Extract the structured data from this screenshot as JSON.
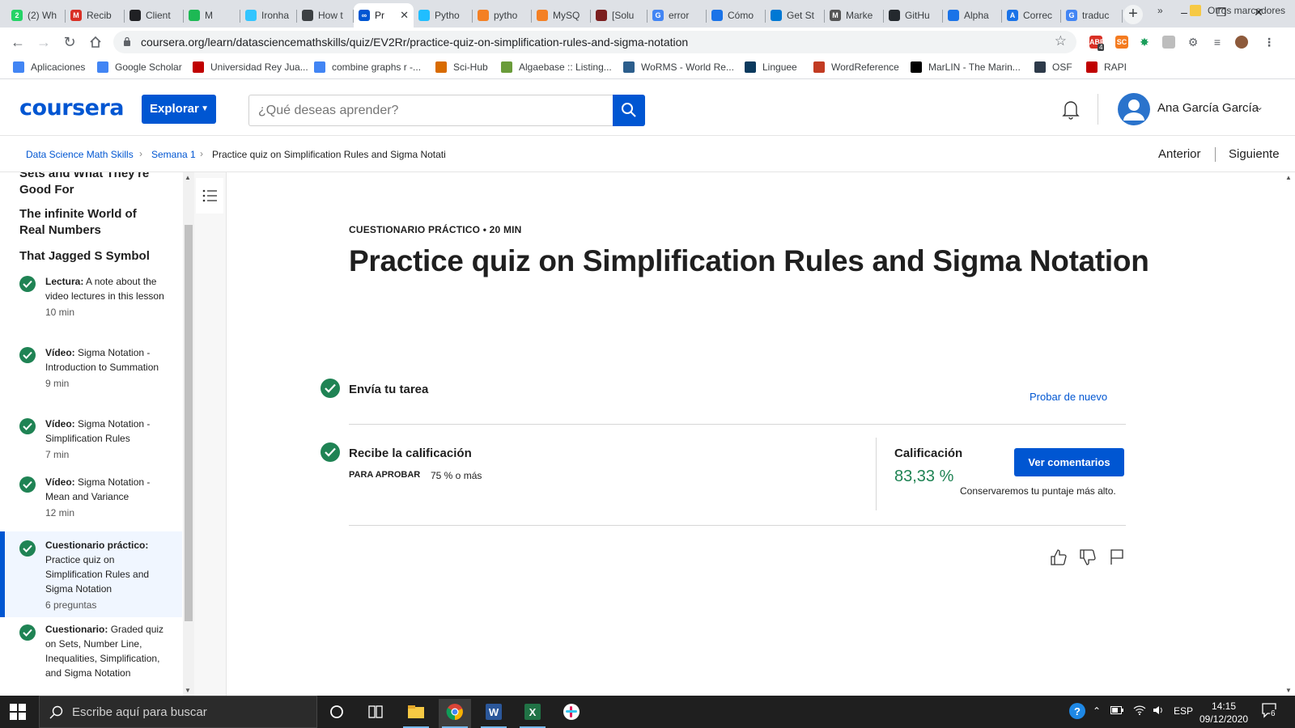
{
  "browser": {
    "tabs": [
      {
        "label": "(2) Wh",
        "color": "#25d366",
        "glyph": "2"
      },
      {
        "label": "Recib",
        "color": "#d93025",
        "glyph": "M"
      },
      {
        "label": "Client",
        "color": "#202124",
        "glyph": ""
      },
      {
        "label": "M",
        "color": "#1db954",
        "glyph": ""
      },
      {
        "label": "Ironha",
        "color": "#32c5ff",
        "glyph": ""
      },
      {
        "label": "How t",
        "color": "#3c4043",
        "glyph": ""
      },
      {
        "label": "Pr",
        "color": "#0056d2",
        "glyph": "∞"
      },
      {
        "label": "Pytho",
        "color": "#20beff",
        "glyph": ""
      },
      {
        "label": "pytho",
        "color": "#f48024",
        "glyph": ""
      },
      {
        "label": "MySQ",
        "color": "#f48024",
        "glyph": ""
      },
      {
        "label": "[Solu",
        "color": "#7b1f1f",
        "glyph": ""
      },
      {
        "label": "error",
        "color": "#4285f4",
        "glyph": "G"
      },
      {
        "label": "Cómo",
        "color": "#1a73e8",
        "glyph": ""
      },
      {
        "label": "Get St",
        "color": "#0078d4",
        "glyph": ""
      },
      {
        "label": "Marke",
        "color": "#555555",
        "glyph": "M"
      },
      {
        "label": "GitHu",
        "color": "#24292e",
        "glyph": ""
      },
      {
        "label": "Alpha",
        "color": "#1a73e8",
        "glyph": ""
      },
      {
        "label": "Correc",
        "color": "#1a73e8",
        "glyph": "A"
      },
      {
        "label": "traduc",
        "color": "#4285f4",
        "glyph": "G"
      }
    ],
    "active_tab_index": 6,
    "url": "coursera.org/learn/datasciencemathskills/quiz/EV2Rr/practice-quiz-on-simplification-rules-and-sigma-notation",
    "bookmarks": [
      {
        "label": "Aplicaciones",
        "icon": "apps-grid-icon",
        "color": "#4285f4"
      },
      {
        "label": "Google Scholar",
        "icon": "scholar-icon",
        "color": "#4285f4"
      },
      {
        "label": "Universidad Rey Jua...",
        "icon": "urjc-icon",
        "color": "#c00000"
      },
      {
        "label": "combine graphs r -...",
        "icon": "google-icon",
        "color": "#4285f4"
      },
      {
        "label": "Sci-Hub",
        "icon": "scihub-icon",
        "color": "#d86b00"
      },
      {
        "label": "Algaebase :: Listing...",
        "icon": "algaebase-icon",
        "color": "#6a9c3a"
      },
      {
        "label": "WoRMS - World Re...",
        "icon": "worms-icon",
        "color": "#2c5e8c"
      },
      {
        "label": "Linguee",
        "icon": "linguee-icon",
        "color": "#0c3a5e"
      },
      {
        "label": "WordReference",
        "icon": "wordreference-icon",
        "color": "#c23b22"
      },
      {
        "label": "MarLIN - The Marin...",
        "icon": "marlin-icon",
        "color": "#000000"
      },
      {
        "label": "OSF",
        "icon": "osf-icon",
        "color": "#2d3a4a"
      },
      {
        "label": "RAPI",
        "icon": "rapi-icon",
        "color": "#c00000"
      }
    ],
    "bookmarks_more": "»",
    "other_bookmarks": "Otros marcadores",
    "ext_badge": "4"
  },
  "header": {
    "logo": "coursera",
    "explore_label": "Explorar",
    "search_placeholder": "¿Qué deseas aprender?",
    "user_name": "Ana García García"
  },
  "breadcrumb": {
    "items": [
      "Data Science Math Skills",
      "Semana 1",
      "Practice quiz on Simplification Rules and Sigma Notati"
    ],
    "separator": "›",
    "prev_label": "Anterior",
    "next_label": "Siguiente"
  },
  "sidebar": {
    "partial_title": "Sets and What They're Good For",
    "sections": [
      "The infinite World of Real Numbers",
      "That Jagged S Symbol"
    ],
    "items": [
      {
        "kind": "Lectura:",
        "text": "A note about the video lectures in this lesson",
        "meta": "10 min"
      },
      {
        "kind": "Vídeo:",
        "text": "Sigma Notation - Introduction to Summation",
        "meta": "9 min"
      },
      {
        "kind": "Vídeo:",
        "text": "Sigma Notation - Simplification Rules",
        "meta": "7 min"
      },
      {
        "kind": "Vídeo:",
        "text": "Sigma Notation - Mean and Variance",
        "meta": "12 min"
      },
      {
        "kind": "Cuestionario práctico:",
        "text": "Practice quiz on Simplification Rules and Sigma Notation",
        "meta": "6 preguntas"
      },
      {
        "kind": "Cuestionario:",
        "text": "Graded quiz on Sets, Number Line, Inequalities, Simplification, and Sigma Notation",
        "meta": ""
      }
    ],
    "active_index": 4
  },
  "quiz": {
    "type_label": "CUESTIONARIO PRÁCTICO • 20 MIN",
    "title": "Practice quiz on Simplification Rules and Sigma Notation",
    "step1_label": "Envía tu tarea",
    "retry_label": "Probar de nuevo",
    "step2_label": "Recibe la calificación",
    "pass_label": "PARA APROBAR",
    "pass_value": "75 % o más",
    "grade_label": "Calificación",
    "grade_value": "83,33 %",
    "feedback_button": "Ver comentarios",
    "keep_note": "Conservaremos tu puntaje más alto."
  },
  "taskbar": {
    "search_placeholder": "Escribe aquí para buscar",
    "lang": "ESP",
    "time": "14:15",
    "date": "09/12/2020",
    "notifications": "6"
  },
  "colors": {
    "brand": "#0056d2",
    "success": "#1f8354",
    "active_bg": "#f0f6ff"
  }
}
